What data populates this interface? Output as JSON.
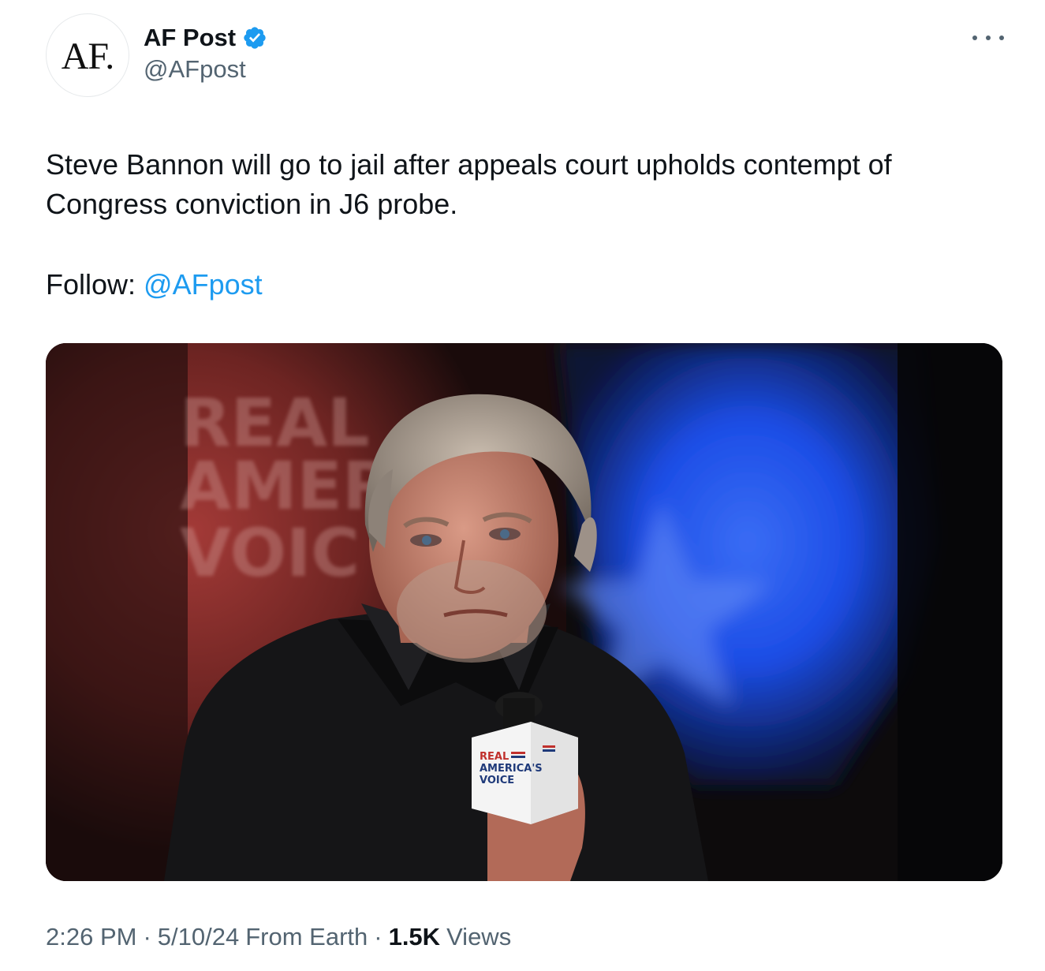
{
  "author": {
    "avatar_text": "AF.",
    "display_name": "AF Post",
    "handle": "@AFpost",
    "verified_color": "#1d9bf0"
  },
  "menu": {
    "more_icon": "more-horizontal-icon"
  },
  "tweet": {
    "text": "Steve Bannon will go to jail after appeals court upholds contempt of Congress conviction in J6 probe.",
    "follow_label": "Follow:",
    "follow_mention": "@AFpost"
  },
  "media": {
    "backdrop_text": [
      "REAL",
      "AMER",
      "VOIC"
    ],
    "mic_flag_text": [
      "REAL",
      "AMERICA'S",
      "VOICE"
    ]
  },
  "meta": {
    "time": "2:26 PM",
    "separator": "·",
    "date": "5/10/24",
    "source": "From Earth",
    "views_count": "1.5K",
    "views_label": "Views"
  },
  "colors": {
    "link": "#1d9bf0",
    "secondary_text": "#536471",
    "primary_text": "#0f1419"
  }
}
